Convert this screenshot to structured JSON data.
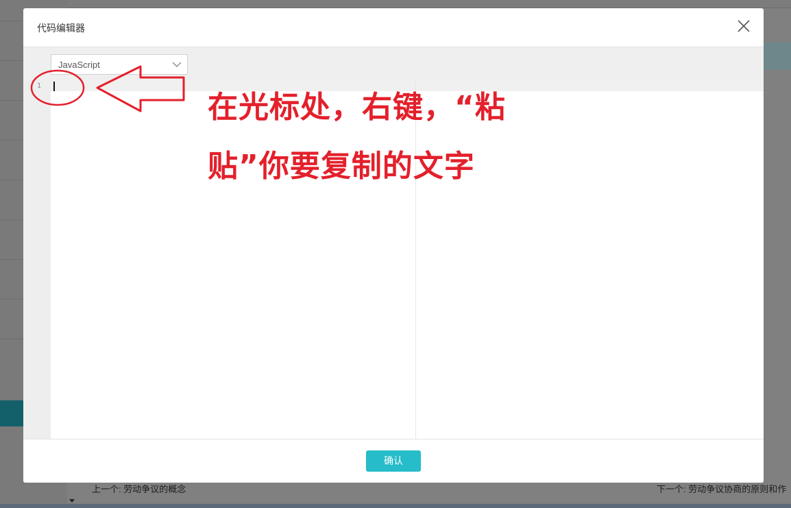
{
  "background": {
    "prev_link": "上一个: 劳动争议的概念",
    "next_link": "下一个: 劳动争议协商的原则和作"
  },
  "modal": {
    "title": "代码编辑器",
    "close_icon": "close-icon",
    "language_select": {
      "value": "JavaScript",
      "icon": "chevron-down-icon"
    },
    "editor": {
      "line_numbers": [
        "1"
      ],
      "content": ""
    },
    "confirm_label": "确认"
  },
  "annotation": {
    "line1": "在光标处，右键，“粘",
    "line2": "贴”你要复制的文字",
    "color": "#e3202b"
  },
  "colors": {
    "accent": "#26bcc9",
    "overlay": "#808080",
    "annotation": "#e3202b"
  }
}
